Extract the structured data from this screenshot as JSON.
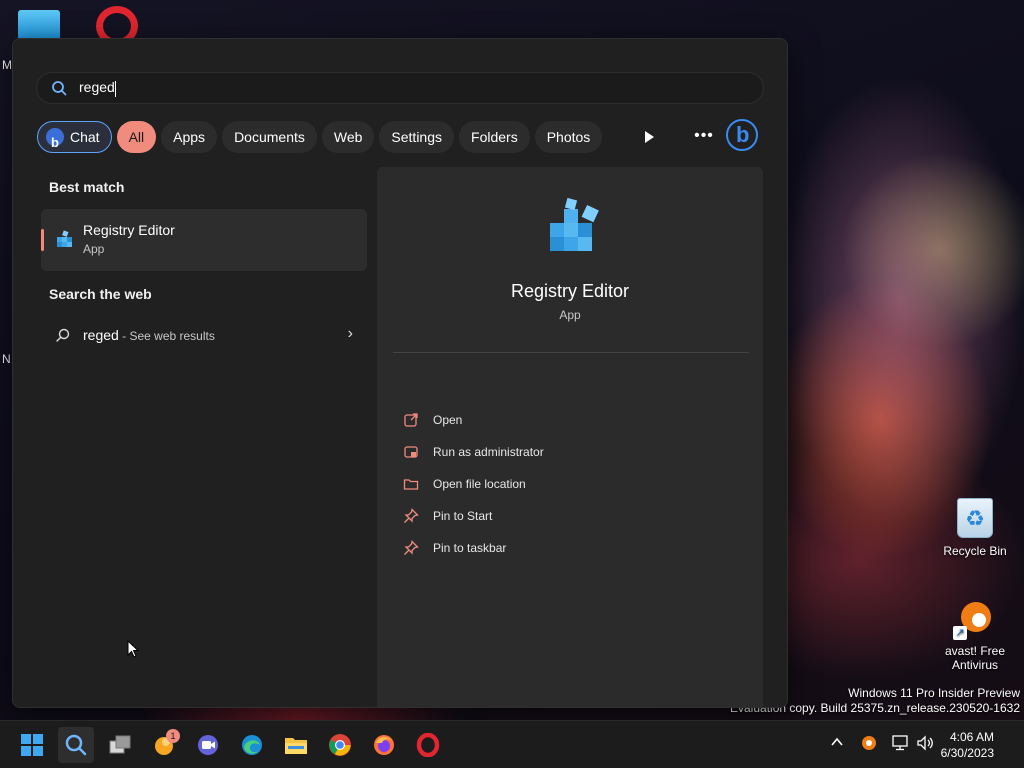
{
  "desktop": {
    "edge_letters": [
      "M",
      "N"
    ],
    "icons": [
      {
        "label": "Recycle Bin",
        "icon": "recycle-bin-icon"
      },
      {
        "label_line1": "avast! Free",
        "label_line2": "Antivirus",
        "icon": "avast-icon"
      }
    ],
    "watermark": {
      "line1": "Windows 11 Pro Insider Preview",
      "line2": "Evaluation copy. Build 25375.zn_release.230520-1632"
    }
  },
  "search": {
    "query": "reged",
    "filters": [
      {
        "label": "Chat",
        "icon": "bing-icon"
      },
      {
        "label": "All",
        "active": true
      },
      {
        "label": "Apps"
      },
      {
        "label": "Documents"
      },
      {
        "label": "Web"
      },
      {
        "label": "Settings"
      },
      {
        "label": "Folders"
      },
      {
        "label": "Photos"
      }
    ],
    "best_match_title": "Best match",
    "best_match": {
      "name": "Registry Editor",
      "type": "App",
      "icon": "registry-editor-icon"
    },
    "web_title": "Search the web",
    "web_result": {
      "query": "reged",
      "hint": " - See web results"
    }
  },
  "preview": {
    "name": "Registry Editor",
    "type": "App",
    "actions": [
      {
        "label": "Open",
        "icon": "open-icon"
      },
      {
        "label": "Run as administrator",
        "icon": "admin-shield-icon"
      },
      {
        "label": "Open file location",
        "icon": "folder-icon"
      },
      {
        "label": "Pin to Start",
        "icon": "pin-icon"
      },
      {
        "label": "Pin to taskbar",
        "icon": "pin-icon"
      }
    ]
  },
  "taskbar": {
    "apps": [
      "start-icon",
      "search-icon",
      "task-view-icon",
      "app-with-badge-icon",
      "teams-chat-icon",
      "edge-icon",
      "file-explorer-icon",
      "chrome-icon",
      "firefox-icon",
      "opera-icon"
    ],
    "badge_count": "1",
    "time": "4:06 AM",
    "date": "6/30/2023"
  },
  "colors": {
    "accent": "#f08b7e",
    "chat_border": "#5ea4ff",
    "flyout_bg": "#202020",
    "pane_bg": "#2b2b2b"
  }
}
